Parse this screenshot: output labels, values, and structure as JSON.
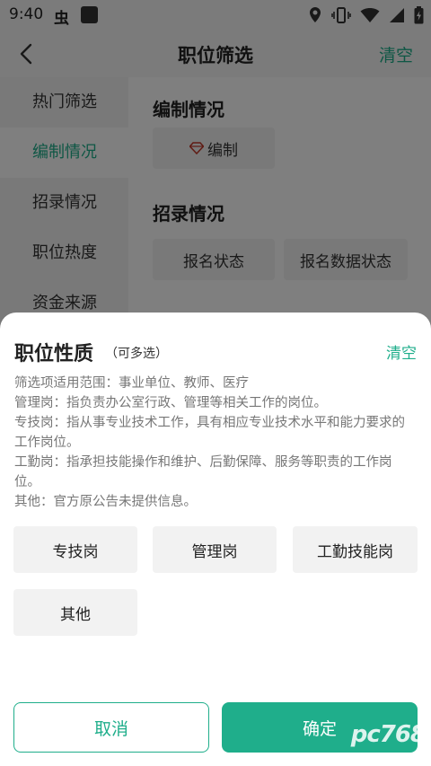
{
  "status_bar": {
    "time": "9:40",
    "app_glyph": "虫",
    "icons": [
      "location-icon",
      "vibrate-icon",
      "wifi-icon",
      "signal-icon",
      "battery-icon"
    ]
  },
  "header": {
    "title": "职位筛选",
    "clear_label": "清空"
  },
  "sidebar": {
    "items": [
      {
        "label": "热门筛选"
      },
      {
        "label": "编制情况"
      },
      {
        "label": "招录情况"
      },
      {
        "label": "职位热度"
      },
      {
        "label": "资金来源"
      }
    ],
    "active_index": 1
  },
  "main": {
    "sections": [
      {
        "title": "编制情况",
        "chips": [
          "编制"
        ]
      },
      {
        "title": "招录情况",
        "chips": [
          "报名状态",
          "报名数据状态"
        ]
      }
    ]
  },
  "sheet": {
    "title": "职位性质",
    "subtitle": "（可多选）",
    "clear_label": "清空",
    "description": [
      "筛选项适用范围：事业单位、教师、医疗",
      "管理岗：指负责办公室行政、管理等相关工作的岗位。",
      "专技岗：指从事专业技术工作，具有相应专业技术水平和能力要求的工作岗位。",
      "工勤岗：指承担技能操作和维护、后勤保障、服务等职责的工作岗位。",
      "其他：官方原公告未提供信息。"
    ],
    "options": [
      "专技岗",
      "管理岗",
      "工勤技能岗",
      "其他"
    ],
    "cancel_label": "取消",
    "confirm_label": "确定"
  },
  "watermark": "pc768",
  "colors": {
    "accent": "#1fae8b",
    "chip_bg": "#f2f2f2",
    "overlay": "rgba(0,0,0,0.5)"
  }
}
